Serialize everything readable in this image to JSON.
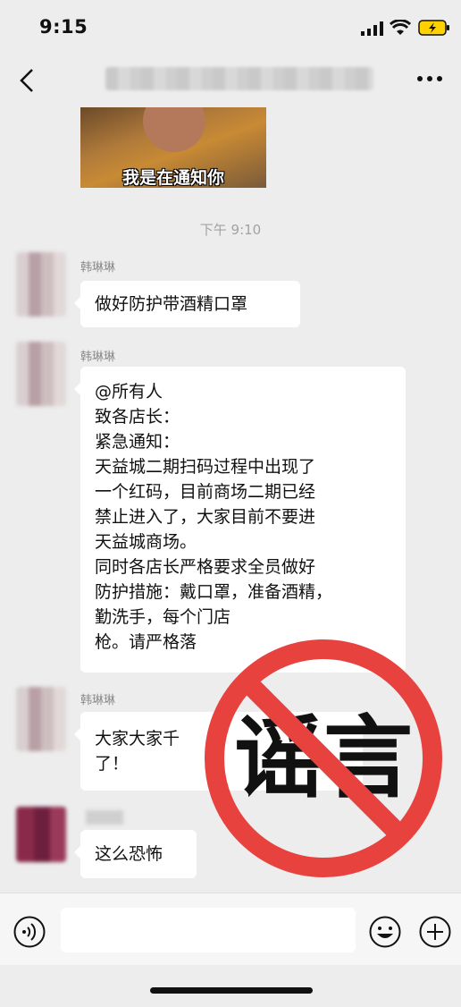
{
  "status_bar": {
    "time": "9:15"
  },
  "nav_bar": {
    "title": ""
  },
  "meme": {
    "caption": "我是在通知你"
  },
  "timestamp": "下午 9:10",
  "messages": [
    {
      "sender": "韩琳琳",
      "lines": [
        "做好防护带酒精口罩"
      ]
    },
    {
      "sender": "韩琳琳",
      "lines": [
        "@所有人",
        "致各店长：",
        "紧急通知：",
        "天益城二期扫码过程中出现了",
        "一个红码，目前商场二期已经",
        "禁止进入了，大家目前不要进",
        "天益城商场。",
        "同时各店长严格要求全员做好",
        "防护措施：戴口罩，准备酒精，",
        "勤洗手，每个门店",
        "枪。请严格落"
      ]
    },
    {
      "sender": "韩琳琳",
      "lines": [
        "大家大家千",
        "了！"
      ]
    },
    {
      "sender": "",
      "lines": [
        "这么恐怖"
      ]
    }
  ],
  "stamp": {
    "text": "谣言",
    "color": "#e8423f"
  },
  "colors": {
    "bubble": "#ffffff",
    "background": "#ededed"
  }
}
